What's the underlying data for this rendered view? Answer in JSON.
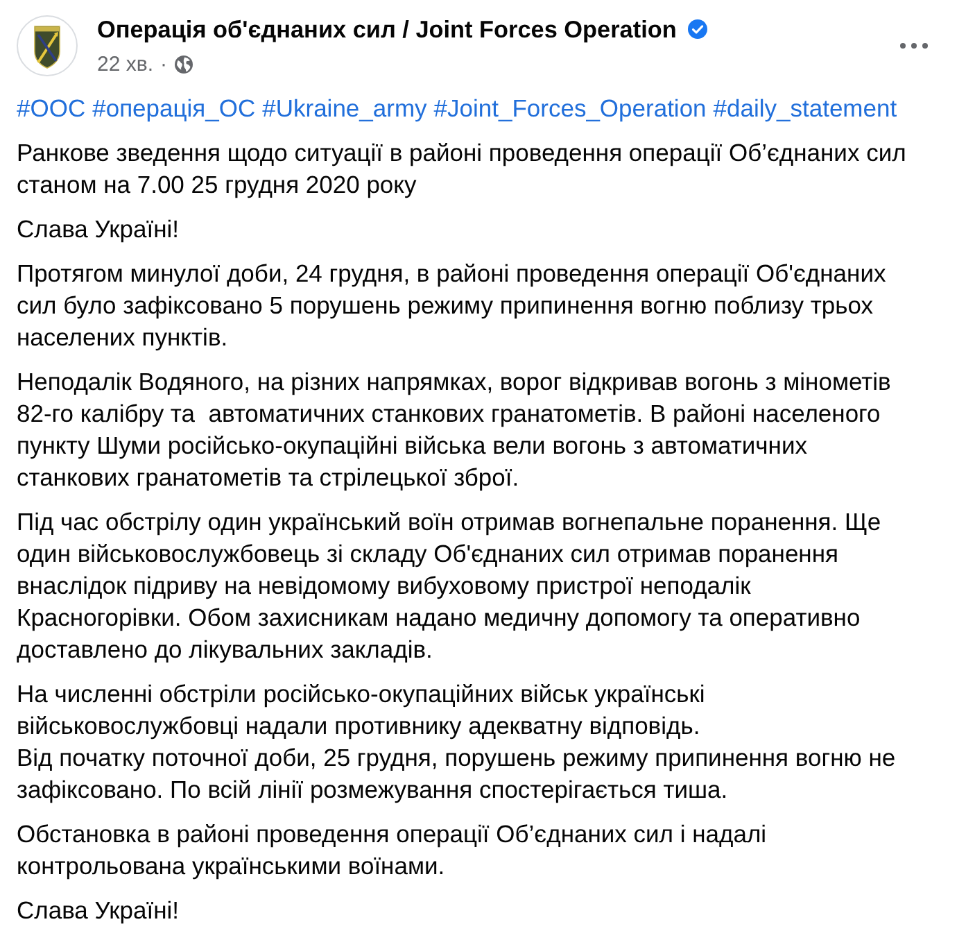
{
  "post": {
    "author": {
      "name": "Операція об'єднаних сил / Joint Forces Operation",
      "verified": true
    },
    "time": "22 хв.",
    "separator": "·",
    "hashtags": [
      "#ООС",
      "#операція_ОС",
      "#Ukraine_army",
      "#Joint_Forces_Operation",
      "#daily_statement"
    ],
    "paragraphs": [
      "Ранкове зведення щодо ситуації в районі проведення операції Об’єднаних сил\nстаном на 7.00 25 грудня 2020 року",
      "Слава Україні!",
      "Протягом минулої доби, 24 грудня, в районі проведення операції Об'єднаних\nсил було зафіксовано 5 порушень режиму припинення вогню поблизу трьох\nнаселених пунктів.",
      "Неподалік Водяного, на різних напрямках, ворог відкривав вогонь з мінометів\n82-го калібру та  автоматичних станкових гранатометів. В районі населеного\nпункту Шуми російсько-окупаційні війська вели вогонь з автоматичних\nстанкових гранатометів та стрілецької зброї.",
      "Під час обстрілу один український воїн отримав вогнепальне поранення. Ще\nодин військовослужбовець зі складу Об'єднаних сил отримав поранення\nвнаслідок підриву на невідомому вибуховому пристрої неподалік\nКрасногорівки. Обом захисникам надано медичну допомогу та оперативно\nдоставлено до лікувальних закладів.",
      "На численні обстріли російсько-окупаційних військ українські\nвійськовослужбовці надали противнику адекватну відповідь.\nВід початку поточної доби, 25 грудня, порушень режиму припинення вогню не\nзафіксовано. По всій лінії розмежування спостерігається тиша.",
      "Обстановка в районі проведення операції Об’єднаних сил і надалі\nконтрольована українськими воїнами.",
      "Слава Україні!"
    ]
  }
}
